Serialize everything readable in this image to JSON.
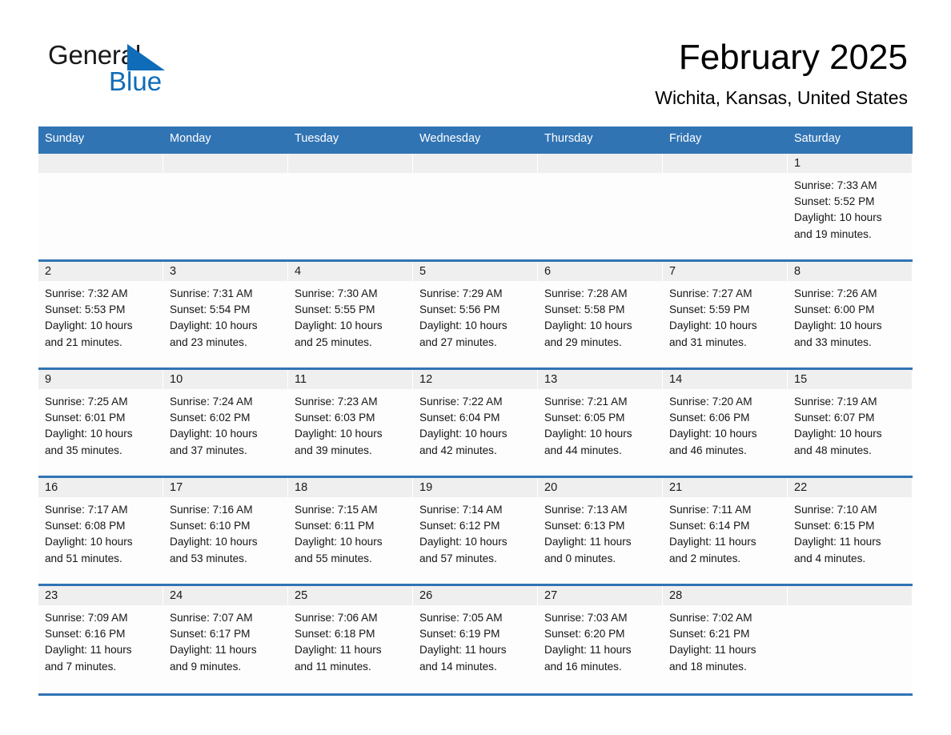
{
  "brand": {
    "name_part1": "General",
    "name_part2": "Blue",
    "triangle_color": "#0f6cb8"
  },
  "header": {
    "title": "February 2025",
    "subtitle": "Wichita, Kansas, United States"
  },
  "theme": {
    "header_blue": "#3174b4",
    "date_band_gray": "#efefef",
    "page_background": "#ffffff"
  },
  "calendar": {
    "weekday_headers": [
      "Sunday",
      "Monday",
      "Tuesday",
      "Wednesday",
      "Thursday",
      "Friday",
      "Saturday"
    ],
    "labels": {
      "sunrise": "Sunrise:",
      "sunset": "Sunset:",
      "daylight": "Daylight:"
    },
    "weeks": [
      [
        {
          "empty": true
        },
        {
          "empty": true
        },
        {
          "empty": true
        },
        {
          "empty": true
        },
        {
          "empty": true
        },
        {
          "empty": true
        },
        {
          "day": "1",
          "sunrise": "Sunrise: 7:33 AM",
          "sunset": "Sunset: 5:52 PM",
          "daylight_line1": "Daylight: 10 hours",
          "daylight_line2": "and 19 minutes."
        }
      ],
      [
        {
          "day": "2",
          "sunrise": "Sunrise: 7:32 AM",
          "sunset": "Sunset: 5:53 PM",
          "daylight_line1": "Daylight: 10 hours",
          "daylight_line2": "and 21 minutes."
        },
        {
          "day": "3",
          "sunrise": "Sunrise: 7:31 AM",
          "sunset": "Sunset: 5:54 PM",
          "daylight_line1": "Daylight: 10 hours",
          "daylight_line2": "and 23 minutes."
        },
        {
          "day": "4",
          "sunrise": "Sunrise: 7:30 AM",
          "sunset": "Sunset: 5:55 PM",
          "daylight_line1": "Daylight: 10 hours",
          "daylight_line2": "and 25 minutes."
        },
        {
          "day": "5",
          "sunrise": "Sunrise: 7:29 AM",
          "sunset": "Sunset: 5:56 PM",
          "daylight_line1": "Daylight: 10 hours",
          "daylight_line2": "and 27 minutes."
        },
        {
          "day": "6",
          "sunrise": "Sunrise: 7:28 AM",
          "sunset": "Sunset: 5:58 PM",
          "daylight_line1": "Daylight: 10 hours",
          "daylight_line2": "and 29 minutes."
        },
        {
          "day": "7",
          "sunrise": "Sunrise: 7:27 AM",
          "sunset": "Sunset: 5:59 PM",
          "daylight_line1": "Daylight: 10 hours",
          "daylight_line2": "and 31 minutes."
        },
        {
          "day": "8",
          "sunrise": "Sunrise: 7:26 AM",
          "sunset": "Sunset: 6:00 PM",
          "daylight_line1": "Daylight: 10 hours",
          "daylight_line2": "and 33 minutes."
        }
      ],
      [
        {
          "day": "9",
          "sunrise": "Sunrise: 7:25 AM",
          "sunset": "Sunset: 6:01 PM",
          "daylight_line1": "Daylight: 10 hours",
          "daylight_line2": "and 35 minutes."
        },
        {
          "day": "10",
          "sunrise": "Sunrise: 7:24 AM",
          "sunset": "Sunset: 6:02 PM",
          "daylight_line1": "Daylight: 10 hours",
          "daylight_line2": "and 37 minutes."
        },
        {
          "day": "11",
          "sunrise": "Sunrise: 7:23 AM",
          "sunset": "Sunset: 6:03 PM",
          "daylight_line1": "Daylight: 10 hours",
          "daylight_line2": "and 39 minutes."
        },
        {
          "day": "12",
          "sunrise": "Sunrise: 7:22 AM",
          "sunset": "Sunset: 6:04 PM",
          "daylight_line1": "Daylight: 10 hours",
          "daylight_line2": "and 42 minutes."
        },
        {
          "day": "13",
          "sunrise": "Sunrise: 7:21 AM",
          "sunset": "Sunset: 6:05 PM",
          "daylight_line1": "Daylight: 10 hours",
          "daylight_line2": "and 44 minutes."
        },
        {
          "day": "14",
          "sunrise": "Sunrise: 7:20 AM",
          "sunset": "Sunset: 6:06 PM",
          "daylight_line1": "Daylight: 10 hours",
          "daylight_line2": "and 46 minutes."
        },
        {
          "day": "15",
          "sunrise": "Sunrise: 7:19 AM",
          "sunset": "Sunset: 6:07 PM",
          "daylight_line1": "Daylight: 10 hours",
          "daylight_line2": "and 48 minutes."
        }
      ],
      [
        {
          "day": "16",
          "sunrise": "Sunrise: 7:17 AM",
          "sunset": "Sunset: 6:08 PM",
          "daylight_line1": "Daylight: 10 hours",
          "daylight_line2": "and 51 minutes."
        },
        {
          "day": "17",
          "sunrise": "Sunrise: 7:16 AM",
          "sunset": "Sunset: 6:10 PM",
          "daylight_line1": "Daylight: 10 hours",
          "daylight_line2": "and 53 minutes."
        },
        {
          "day": "18",
          "sunrise": "Sunrise: 7:15 AM",
          "sunset": "Sunset: 6:11 PM",
          "daylight_line1": "Daylight: 10 hours",
          "daylight_line2": "and 55 minutes."
        },
        {
          "day": "19",
          "sunrise": "Sunrise: 7:14 AM",
          "sunset": "Sunset: 6:12 PM",
          "daylight_line1": "Daylight: 10 hours",
          "daylight_line2": "and 57 minutes."
        },
        {
          "day": "20",
          "sunrise": "Sunrise: 7:13 AM",
          "sunset": "Sunset: 6:13 PM",
          "daylight_line1": "Daylight: 11 hours",
          "daylight_line2": "and 0 minutes."
        },
        {
          "day": "21",
          "sunrise": "Sunrise: 7:11 AM",
          "sunset": "Sunset: 6:14 PM",
          "daylight_line1": "Daylight: 11 hours",
          "daylight_line2": "and 2 minutes."
        },
        {
          "day": "22",
          "sunrise": "Sunrise: 7:10 AM",
          "sunset": "Sunset: 6:15 PM",
          "daylight_line1": "Daylight: 11 hours",
          "daylight_line2": "and 4 minutes."
        }
      ],
      [
        {
          "day": "23",
          "sunrise": "Sunrise: 7:09 AM",
          "sunset": "Sunset: 6:16 PM",
          "daylight_line1": "Daylight: 11 hours",
          "daylight_line2": "and 7 minutes."
        },
        {
          "day": "24",
          "sunrise": "Sunrise: 7:07 AM",
          "sunset": "Sunset: 6:17 PM",
          "daylight_line1": "Daylight: 11 hours",
          "daylight_line2": "and 9 minutes."
        },
        {
          "day": "25",
          "sunrise": "Sunrise: 7:06 AM",
          "sunset": "Sunset: 6:18 PM",
          "daylight_line1": "Daylight: 11 hours",
          "daylight_line2": "and 11 minutes."
        },
        {
          "day": "26",
          "sunrise": "Sunrise: 7:05 AM",
          "sunset": "Sunset: 6:19 PM",
          "daylight_line1": "Daylight: 11 hours",
          "daylight_line2": "and 14 minutes."
        },
        {
          "day": "27",
          "sunrise": "Sunrise: 7:03 AM",
          "sunset": "Sunset: 6:20 PM",
          "daylight_line1": "Daylight: 11 hours",
          "daylight_line2": "and 16 minutes."
        },
        {
          "day": "28",
          "sunrise": "Sunrise: 7:02 AM",
          "sunset": "Sunset: 6:21 PM",
          "daylight_line1": "Daylight: 11 hours",
          "daylight_line2": "and 18 minutes."
        },
        {
          "empty": true
        }
      ]
    ]
  }
}
